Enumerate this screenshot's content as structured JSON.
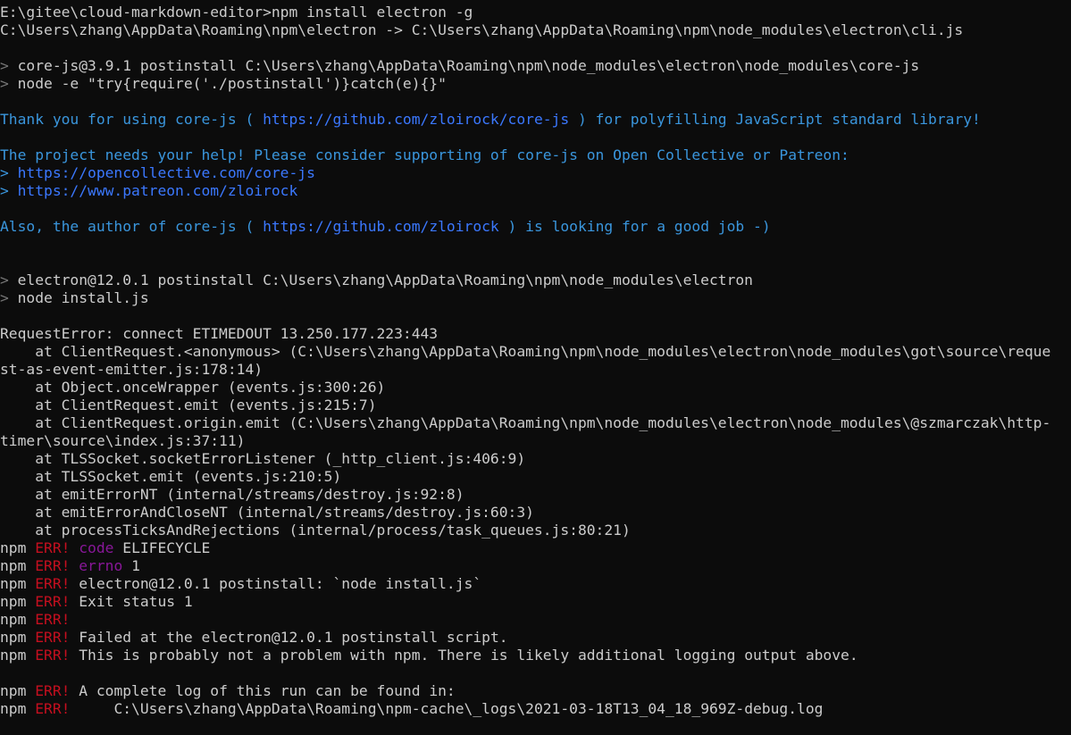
{
  "colors": {
    "background": "#0c0c0c",
    "default_text": "#cccccc",
    "prompt_gray": "#767676",
    "cyan": "#3a96dd",
    "link_blue": "#3b78ff",
    "error_red": "#c50f1f",
    "code_magenta": "#881798"
  },
  "lines": [
    {
      "segments": [
        {
          "text": "E:\\gitee\\cloud-markdown-editor>npm install electron -g",
          "style": "default"
        }
      ]
    },
    {
      "segments": [
        {
          "text": "C:\\Users\\zhang\\AppData\\Roaming\\npm\\electron -> C:\\Users\\zhang\\AppData\\Roaming\\npm\\node_modules\\electron\\cli.js",
          "style": "default"
        }
      ]
    },
    {
      "segments": []
    },
    {
      "segments": [
        {
          "text": "> ",
          "style": "gray"
        },
        {
          "text": "core-js@3.9.1 postinstall C:\\Users\\zhang\\AppData\\Roaming\\npm\\node_modules\\electron\\node_modules\\core-js",
          "style": "default"
        }
      ]
    },
    {
      "segments": [
        {
          "text": "> ",
          "style": "gray"
        },
        {
          "text": "node -e \"try{require('./postinstall')}catch(e){}\"",
          "style": "default"
        }
      ]
    },
    {
      "segments": []
    },
    {
      "segments": [
        {
          "text": "Thank you for using core-js ( ",
          "style": "cyan"
        },
        {
          "text": "https://github.com/zloirock/core-js",
          "style": "link"
        },
        {
          "text": " ) for polyfilling JavaScript standard library!",
          "style": "cyan"
        }
      ]
    },
    {
      "segments": []
    },
    {
      "segments": [
        {
          "text": "The project needs your help! Please consider supporting of core-js on Open Collective or Patreon:",
          "style": "cyan"
        }
      ]
    },
    {
      "segments": [
        {
          "text": "> ",
          "style": "cyan"
        },
        {
          "text": "https://opencollective.com/core-js",
          "style": "link"
        }
      ]
    },
    {
      "segments": [
        {
          "text": "> ",
          "style": "cyan"
        },
        {
          "text": "https://www.patreon.com/zloirock",
          "style": "link"
        }
      ]
    },
    {
      "segments": []
    },
    {
      "segments": [
        {
          "text": "Also, the author of core-js ( ",
          "style": "cyan"
        },
        {
          "text": "https://github.com/zloirock",
          "style": "link"
        },
        {
          "text": " ) is looking for a good job -)",
          "style": "cyan"
        }
      ]
    },
    {
      "segments": []
    },
    {
      "segments": []
    },
    {
      "segments": [
        {
          "text": "> ",
          "style": "gray"
        },
        {
          "text": "electron@12.0.1 postinstall C:\\Users\\zhang\\AppData\\Roaming\\npm\\node_modules\\electron",
          "style": "default"
        }
      ]
    },
    {
      "segments": [
        {
          "text": "> ",
          "style": "gray"
        },
        {
          "text": "node install.js",
          "style": "default"
        }
      ]
    },
    {
      "segments": []
    },
    {
      "segments": [
        {
          "text": "RequestError: connect ETIMEDOUT 13.250.177.223:443",
          "style": "default"
        }
      ]
    },
    {
      "segments": [
        {
          "text": "    at ClientRequest.<anonymous> (C:\\Users\\zhang\\AppData\\Roaming\\npm\\node_modules\\electron\\node_modules\\got\\source\\reque",
          "style": "default"
        }
      ]
    },
    {
      "segments": [
        {
          "text": "st-as-event-emitter.js:178:14)",
          "style": "default"
        }
      ]
    },
    {
      "segments": [
        {
          "text": "    at Object.onceWrapper (events.js:300:26)",
          "style": "default"
        }
      ]
    },
    {
      "segments": [
        {
          "text": "    at ClientRequest.emit (events.js:215:7)",
          "style": "default"
        }
      ]
    },
    {
      "segments": [
        {
          "text": "    at ClientRequest.origin.emit (C:\\Users\\zhang\\AppData\\Roaming\\npm\\node_modules\\electron\\node_modules\\@szmarczak\\http-",
          "style": "default"
        }
      ]
    },
    {
      "segments": [
        {
          "text": "timer\\source\\index.js:37:11)",
          "style": "default"
        }
      ]
    },
    {
      "segments": [
        {
          "text": "    at TLSSocket.socketErrorListener (_http_client.js:406:9)",
          "style": "default"
        }
      ]
    },
    {
      "segments": [
        {
          "text": "    at TLSSocket.emit (events.js:210:5)",
          "style": "default"
        }
      ]
    },
    {
      "segments": [
        {
          "text": "    at emitErrorNT (internal/streams/destroy.js:92:8)",
          "style": "default"
        }
      ]
    },
    {
      "segments": [
        {
          "text": "    at emitErrorAndCloseNT (internal/streams/destroy.js:60:3)",
          "style": "default"
        }
      ]
    },
    {
      "segments": [
        {
          "text": "    at processTicksAndRejections (internal/process/task_queues.js:80:21)",
          "style": "default"
        }
      ]
    },
    {
      "segments": [
        {
          "text": "npm ",
          "style": "default"
        },
        {
          "text": "ERR!",
          "style": "err"
        },
        {
          "text": " ",
          "style": "default"
        },
        {
          "text": "code",
          "style": "magenta"
        },
        {
          "text": " ELIFECYCLE",
          "style": "default"
        }
      ]
    },
    {
      "segments": [
        {
          "text": "npm ",
          "style": "default"
        },
        {
          "text": "ERR!",
          "style": "err"
        },
        {
          "text": " ",
          "style": "default"
        },
        {
          "text": "errno",
          "style": "magenta"
        },
        {
          "text": " 1",
          "style": "default"
        }
      ]
    },
    {
      "segments": [
        {
          "text": "npm ",
          "style": "default"
        },
        {
          "text": "ERR!",
          "style": "err"
        },
        {
          "text": " electron@12.0.1 postinstall: `node install.js`",
          "style": "default"
        }
      ]
    },
    {
      "segments": [
        {
          "text": "npm ",
          "style": "default"
        },
        {
          "text": "ERR!",
          "style": "err"
        },
        {
          "text": " Exit status 1",
          "style": "default"
        }
      ]
    },
    {
      "segments": [
        {
          "text": "npm ",
          "style": "default"
        },
        {
          "text": "ERR!",
          "style": "err"
        }
      ]
    },
    {
      "segments": [
        {
          "text": "npm ",
          "style": "default"
        },
        {
          "text": "ERR!",
          "style": "err"
        },
        {
          "text": " Failed at the electron@12.0.1 postinstall script.",
          "style": "default"
        }
      ]
    },
    {
      "segments": [
        {
          "text": "npm ",
          "style": "default"
        },
        {
          "text": "ERR!",
          "style": "err"
        },
        {
          "text": " This is probably not a problem with npm. There is likely additional logging output above.",
          "style": "default"
        }
      ]
    },
    {
      "segments": []
    },
    {
      "segments": [
        {
          "text": "npm ",
          "style": "default"
        },
        {
          "text": "ERR!",
          "style": "err"
        },
        {
          "text": " A complete log of this run can be found in:",
          "style": "default"
        }
      ]
    },
    {
      "segments": [
        {
          "text": "npm ",
          "style": "default"
        },
        {
          "text": "ERR!",
          "style": "err"
        },
        {
          "text": "     C:\\Users\\zhang\\AppData\\Roaming\\npm-cache\\_logs\\2021-03-18T13_04_18_969Z-debug.log",
          "style": "default"
        }
      ]
    }
  ]
}
